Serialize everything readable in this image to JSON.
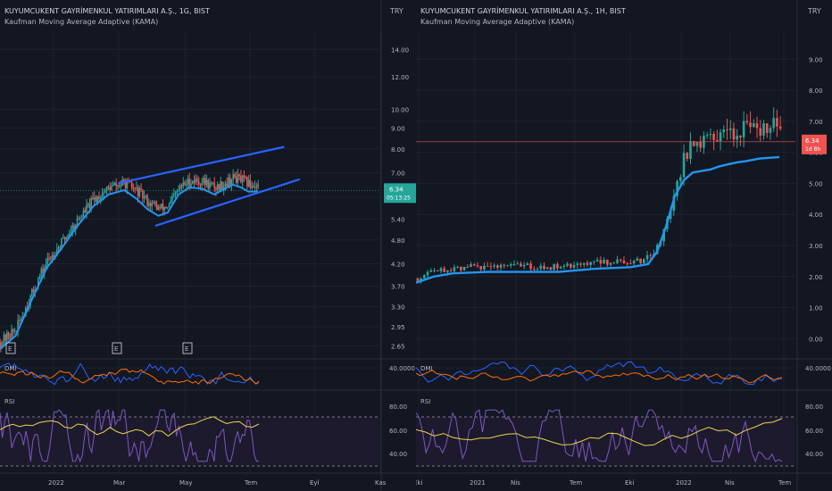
{
  "colors": {
    "background": "#131722",
    "grid": "#1e222d",
    "text": "#b2b5be",
    "up": "#26a69a",
    "down": "#ef5350",
    "kama": "#2196f3",
    "channel": "#2962ff",
    "dmi_plus": "#2962ff",
    "dmi_minus": "#ff6d00",
    "rsi": "#7e57c2",
    "rsi_ma": "#e8d44d",
    "rsi_band": "#1f1b2f"
  },
  "chart_data": [
    {
      "type": "candlestick",
      "title": "KUYUMCUKENT GAYRİMENKUL YATIRIMLARI A.Ş., 1G, BIST",
      "indicator": "Kaufman Moving Average Adaptive (KAMA)",
      "currency": "TRY",
      "yscale": "log",
      "yticks": [
        "14.00",
        "12.00",
        "10.00",
        "9.00",
        "8.00",
        "7.00",
        "6.10",
        "5.40",
        "4.80",
        "4.20",
        "3.70",
        "3.30",
        "2.95",
        "2.65"
      ],
      "ylim": [
        2.55,
        15.5
      ],
      "xticks": [
        "2022",
        "Mar",
        "May",
        "Tem",
        "Eyl",
        "Kas"
      ],
      "last_price": "6.34",
      "countdown": "05:13:25",
      "event_markers": [
        "E",
        "E",
        "E"
      ],
      "kama": [
        [
          0,
          2.6
        ],
        [
          10,
          2.8
        ],
        [
          20,
          3.4
        ],
        [
          30,
          4.1
        ],
        [
          40,
          4.6
        ],
        [
          50,
          5.2
        ],
        [
          60,
          5.8
        ],
        [
          70,
          6.2
        ],
        [
          80,
          6.35
        ],
        [
          88,
          6.05
        ],
        [
          95,
          5.7
        ],
        [
          102,
          5.5
        ],
        [
          108,
          5.6
        ],
        [
          115,
          6.2
        ],
        [
          122,
          6.45
        ],
        [
          130,
          6.4
        ],
        [
          138,
          6.2
        ],
        [
          145,
          6.4
        ],
        [
          150,
          6.55
        ],
        [
          155,
          6.45
        ],
        [
          160,
          6.3
        ],
        [
          166,
          6.3
        ]
      ],
      "channel_upper": [
        [
          76,
          6.6
        ],
        [
          183,
          8.1
        ]
      ],
      "channel_lower": [
        [
          100,
          5.2
        ],
        [
          193,
          6.75
        ]
      ],
      "price_range": [
        2.6,
        7.4
      ],
      "date_range": [
        "2021-11",
        "2022-07"
      ],
      "dmi_label": "DMI",
      "dmi_ticks": [
        "40.0000"
      ],
      "rsi_label": "RSI",
      "rsi_ticks": [
        "80.00",
        "60.00",
        "40.00"
      ]
    },
    {
      "type": "candlestick",
      "title": "KUYUMCUKENT GAYRİMENKUL YATIRIMLARI A.Ş., 1H, BIST",
      "indicator": "Kaufman Moving Average Adaptive (KAMA)",
      "currency": "TRY",
      "yscale": "linear",
      "yticks": [
        "9.00",
        "8.00",
        "7.00",
        "6.00",
        "5.00",
        "4.00",
        "3.00",
        "2.00",
        "1.00",
        "0.00"
      ],
      "ylim": [
        -0.45,
        9.9
      ],
      "xticks": [
        "Eki",
        "2021",
        "Nis",
        "Tem",
        "Eki",
        "2022",
        "Nis",
        "Tem"
      ],
      "last_price": "6.34",
      "countdown": "1d 8h",
      "kama": [
        [
          0,
          1.8
        ],
        [
          20,
          2.0
        ],
        [
          40,
          2.1
        ],
        [
          80,
          2.15
        ],
        [
          120,
          2.15
        ],
        [
          160,
          2.15
        ],
        [
          180,
          2.2
        ],
        [
          200,
          2.25
        ],
        [
          240,
          2.3
        ],
        [
          260,
          2.4
        ],
        [
          270,
          2.8
        ],
        [
          280,
          3.6
        ],
        [
          290,
          4.6
        ],
        [
          300,
          5.1
        ],
        [
          310,
          5.35
        ],
        [
          320,
          5.4
        ],
        [
          330,
          5.45
        ],
        [
          340,
          5.55
        ],
        [
          350,
          5.62
        ],
        [
          360,
          5.68
        ],
        [
          370,
          5.72
        ],
        [
          385,
          5.8
        ],
        [
          407,
          5.85
        ]
      ],
      "price_range": [
        1.9,
        7.4
      ],
      "date_range": [
        "2020-10",
        "2022-07"
      ],
      "dmi_label": "DMI",
      "dmi_ticks": [
        "40.0000"
      ],
      "rsi_label": "RSI",
      "rsi_ticks": [
        "80.00",
        "60.00",
        "40.00"
      ]
    }
  ]
}
